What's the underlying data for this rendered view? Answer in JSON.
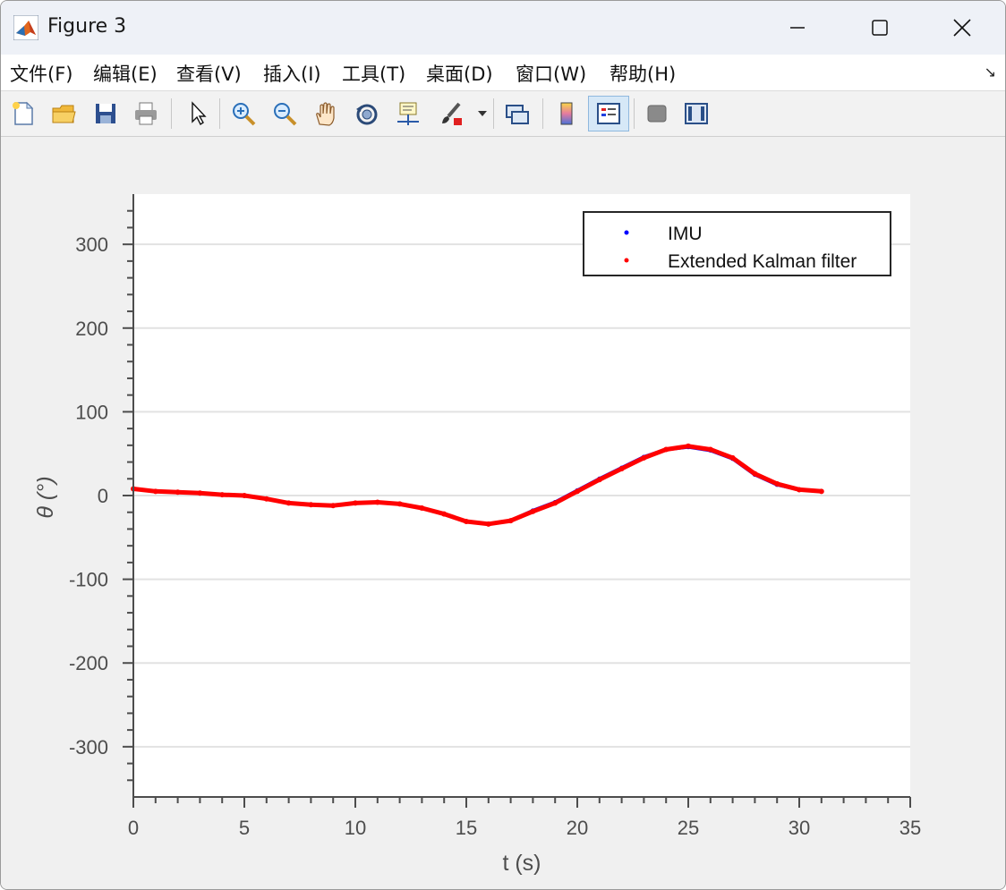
{
  "window": {
    "title": "Figure 3"
  },
  "menu": [
    {
      "label": "文件(F)"
    },
    {
      "label": "编辑(E)"
    },
    {
      "label": "查看(V)"
    },
    {
      "label": "插入(I)"
    },
    {
      "label": "工具(T)"
    },
    {
      "label": "桌面(D)"
    },
    {
      "label": "窗口(W)"
    },
    {
      "label": "帮助(H)"
    }
  ],
  "toolbar": {
    "icons": [
      "new-figure-icon",
      "open-folder-icon",
      "save-icon",
      "print-icon",
      "pointer-icon",
      "zoom-in-icon",
      "zoom-out-icon",
      "pan-hand-icon",
      "rotate-3d-icon",
      "data-cursor-icon",
      "brush-icon",
      "link-plot-icon",
      "colorbar-icon",
      "legend-icon",
      "hide-plot-tools-icon",
      "show-plot-tools-icon"
    ]
  },
  "chart_data": {
    "type": "scatter",
    "title": "",
    "xlabel": "t (s)",
    "ylabel": "θ (°)",
    "xlim": [
      0,
      35
    ],
    "ylim": [
      -360,
      360
    ],
    "xticks": [
      0,
      5,
      10,
      15,
      20,
      25,
      30,
      35
    ],
    "yticks": [
      -300,
      -200,
      -100,
      0,
      100,
      200,
      300
    ],
    "xtick_labels": [
      "0",
      "5",
      "10",
      "15",
      "20",
      "25",
      "30",
      "35"
    ],
    "ytick_labels": [
      "-300",
      "-200",
      "-100",
      "0",
      "100",
      "200",
      "300"
    ],
    "grid": "horizontal",
    "legend": {
      "position": "top-right",
      "entries": [
        "IMU",
        "Extended Kalman filter"
      ]
    },
    "series": [
      {
        "name": "IMU",
        "color": "#0000ff",
        "x": [
          0,
          1,
          2,
          3,
          4,
          5,
          6,
          7,
          8,
          9,
          10,
          11,
          12,
          13,
          14,
          15,
          16,
          17,
          18,
          19,
          20,
          21,
          22,
          23,
          24,
          25,
          26,
          27,
          28,
          29,
          30,
          31
        ],
        "y": [
          8,
          5,
          4,
          3,
          1,
          0,
          -4,
          -9,
          -11,
          -12,
          -9,
          -8,
          -10,
          -15,
          -22,
          -31,
          -34,
          -30,
          -18,
          -8,
          6,
          20,
          33,
          46,
          55,
          58,
          54,
          44,
          25,
          13,
          7,
          5
        ]
      },
      {
        "name": "Extended Kalman filter",
        "color": "#ff0000",
        "x": [
          0,
          1,
          2,
          3,
          4,
          5,
          6,
          7,
          8,
          9,
          10,
          11,
          12,
          13,
          14,
          15,
          16,
          17,
          18,
          19,
          20,
          21,
          22,
          23,
          24,
          25,
          26,
          27,
          28,
          29,
          30,
          31
        ],
        "y": [
          8,
          5,
          4,
          3,
          1,
          0,
          -4,
          -9,
          -11,
          -12,
          -9,
          -8,
          -10,
          -15,
          -22,
          -31,
          -34,
          -30,
          -19,
          -9,
          5,
          19,
          32,
          45,
          55,
          59,
          55,
          45,
          26,
          14,
          7,
          5
        ]
      }
    ]
  }
}
